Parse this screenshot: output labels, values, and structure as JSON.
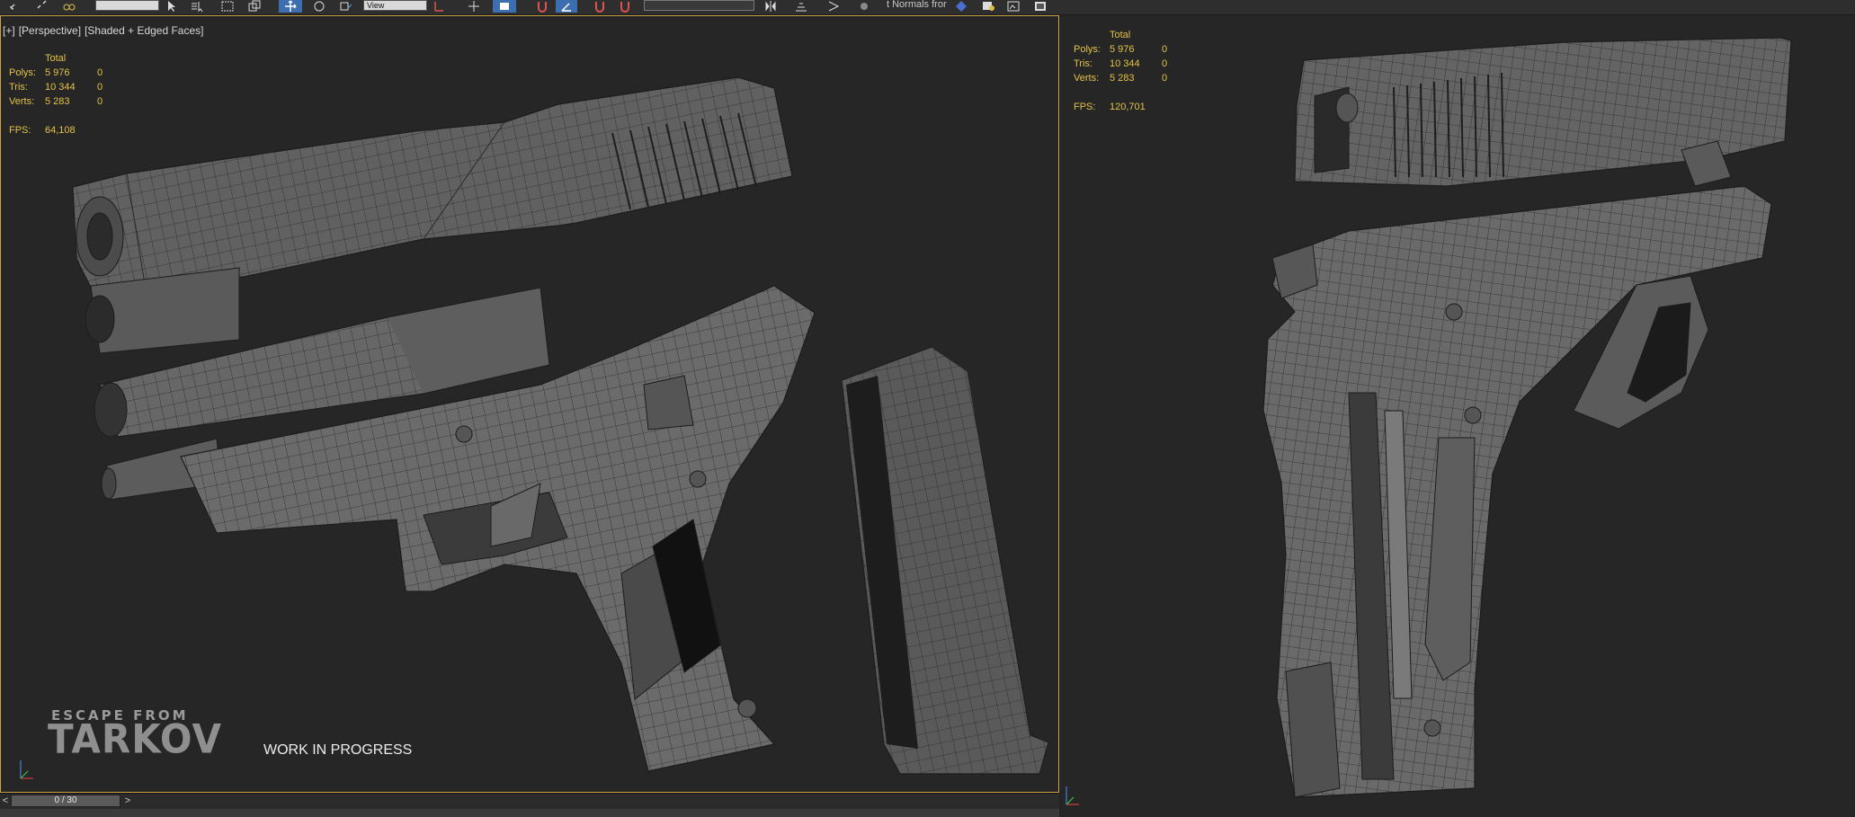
{
  "toolbar": {
    "named_selection_value": "View",
    "normals_text": "t Normals fror",
    "icons": [
      "link-icon",
      "unlink-icon",
      "bind-icon",
      "select-icon",
      "select-by-name-icon",
      "rect-region-icon",
      "window-crossing-icon",
      "move-icon",
      "rotate-icon",
      "reference-coord-icon",
      "pivot-icon",
      "snap-icon",
      "angle-snap-icon",
      "percent-snap-icon",
      "spinner-snap-icon",
      "mirror-icon",
      "align-icon",
      "layer-icon",
      "graphite-icon",
      "material-editor-icon",
      "render-setup-icon",
      "render-frame-icon"
    ]
  },
  "viewport_left": {
    "label_plus": "[+]",
    "label_view": "[Perspective]",
    "label_shading": "[Shaded + Edged Faces]",
    "stats": {
      "header": "Total",
      "polys_label": "Polys:",
      "polys_value": "5 976",
      "polys_sel": "0",
      "tris_label": "Tris:",
      "tris_value": "10 344",
      "tris_sel": "0",
      "verts_label": "Verts:",
      "verts_value": "5 283",
      "verts_sel": "0",
      "fps_label": "FPS:",
      "fps_value": "64,108"
    },
    "logo_top": "ESCAPE FROM",
    "logo_main": "TARKOV",
    "wip_text": "WORK IN PROGRESS"
  },
  "viewport_right": {
    "stats": {
      "header": "Total",
      "polys_label": "Polys:",
      "polys_value": "5 976",
      "polys_sel": "0",
      "tris_label": "Tris:",
      "tris_value": "10 344",
      "tris_sel": "0",
      "verts_label": "Verts:",
      "verts_value": "5 283",
      "verts_sel": "0",
      "fps_label": "FPS:",
      "fps_value": "120,701"
    }
  },
  "timeline": {
    "prev_label": "<",
    "next_label": ">",
    "frame_text": "0 / 30"
  },
  "colors": {
    "viewport_bg": "#262626",
    "active_border": "#caa24a",
    "stats_text": "#e3c247",
    "model_gray": "#6e6e6e"
  }
}
